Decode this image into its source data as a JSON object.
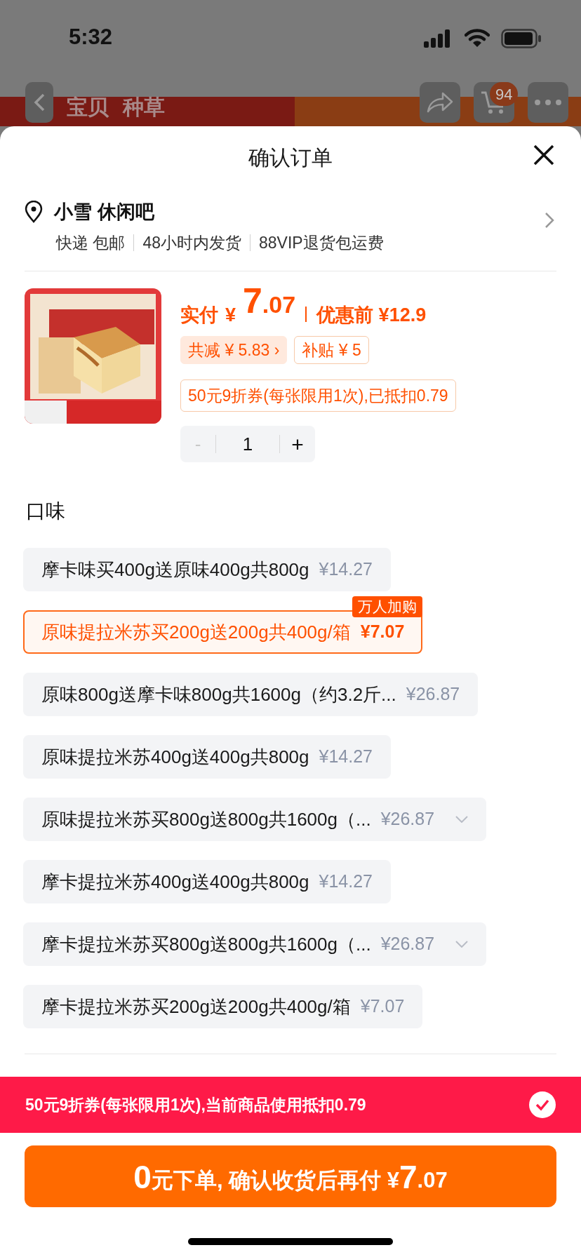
{
  "status_bar": {
    "time": "5:32"
  },
  "background_page": {
    "tabs": [
      {
        "label": "宝贝"
      },
      {
        "label": "种草"
      }
    ],
    "cart_count": "94"
  },
  "sheet": {
    "title": "确认订单"
  },
  "address": {
    "name": "小雪 休闲吧",
    "details": [
      "快递 包邮",
      "48小时内发货",
      "88VIP退货包运费"
    ]
  },
  "product": {
    "price": {
      "label": "实付",
      "currency": "¥",
      "integer": "7",
      "fraction": ".07",
      "original": "优惠前 ¥12.9"
    },
    "badges": [
      {
        "kind": "filled",
        "text": "共减 ¥ 5.83 ›"
      },
      {
        "kind": "outline",
        "text": "补贴 ¥ 5"
      }
    ],
    "coupon": "50元9折券(每张限用1次),已抵扣0.79",
    "quantity": {
      "minus": "-",
      "value": "1",
      "plus": "+",
      "minus_disabled": true
    }
  },
  "options_section": {
    "heading": "口味",
    "options": [
      {
        "label": "摩卡味买400g送原味400g共800g",
        "price": "¥14.27",
        "selected": false,
        "dropdown": false
      },
      {
        "label": "原味提拉米苏买200g送200g共400g/箱",
        "price": "¥7.07",
        "selected": true,
        "dropdown": false,
        "badge": "万人加购"
      },
      {
        "label": "原味800g送摩卡味800g共1600g（约3.2斤...",
        "price": "¥26.87",
        "selected": false,
        "dropdown": false
      },
      {
        "label": "原味提拉米苏400g送400g共800g",
        "price": "¥14.27",
        "selected": false,
        "dropdown": false
      },
      {
        "label": "原味提拉米苏买800g送800g共1600g（...",
        "price": "¥26.87",
        "selected": false,
        "dropdown": true
      },
      {
        "label": "摩卡提拉米苏400g送400g共800g",
        "price": "¥14.27",
        "selected": false,
        "dropdown": false
      },
      {
        "label": "摩卡提拉米苏买800g送800g共1600g（...",
        "price": "¥26.87",
        "selected": false,
        "dropdown": true
      },
      {
        "label": "摩卡提拉米苏买200g送200g共400g/箱",
        "price": "¥7.07",
        "selected": false,
        "dropdown": false
      }
    ]
  },
  "coupon_banner": {
    "text": "50元9折券(每张限用1次),当前商品使用抵扣0.79",
    "checked": true
  },
  "submit_button": {
    "parts": [
      {
        "text": "0",
        "big": true
      },
      {
        "text": "元下单, 确认收货后再付 ¥",
        "big": false
      },
      {
        "text": "7",
        "big": true
      },
      {
        "text": ".07",
        "big": false
      }
    ]
  }
}
